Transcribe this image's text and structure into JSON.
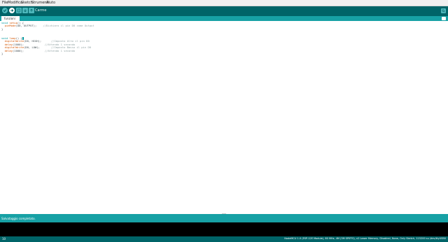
{
  "menubar": {
    "items": [
      "File",
      "Modifica",
      "Sketch",
      "Strumenti",
      "Aiuto"
    ]
  },
  "toolbar": {
    "buttons": [
      "verify-icon",
      "upload-icon",
      "new-icon",
      "open-icon",
      "save-icon"
    ],
    "sketch_name": "Carme"
  },
  "tabs": {
    "active": "funzioni"
  },
  "editor": {
    "lines": [
      {
        "kw": "void",
        "fn": "setup",
        "rest": "() {",
        "cm": ""
      },
      {
        "kw": "",
        "fn": "  pinMode",
        "rest": "(D0, OUTPUT);",
        "cm": "    //Dichiaro il pin D0 come Output"
      },
      {
        "kw": "",
        "fn": "",
        "rest": "}",
        "cm": ""
      },
      {
        "kw": "",
        "fn": "",
        "rest": "",
        "cm": ""
      },
      {
        "kw": "",
        "fn": "",
        "rest": "",
        "cm": ""
      },
      {
        "kw": "void",
        "fn": "loop",
        "rest": "() {",
        "cm": ""
      },
      {
        "kw": "",
        "fn": "  digitalWrite",
        "rest": "(D0, HIGH);",
        "cm": "      //Imposto Alto il pin D0"
      },
      {
        "kw": "",
        "fn": "  delay",
        "rest": "(1000);",
        "cm": "             //Attendo 1 secondo"
      },
      {
        "kw": "",
        "fn": "  digitalWrite",
        "rest": "(D0, LOW);",
        "cm": "       //Imposto Basso il pin D0"
      },
      {
        "kw": "",
        "fn": "  delay",
        "rest": "(1000);",
        "cm": "             //Attendo 1 secondo"
      },
      {
        "kw": "",
        "fn": "",
        "rest": "}",
        "cm": ""
      }
    ]
  },
  "status": {
    "text": "Salvataggio completato."
  },
  "footer": {
    "line_number": "10",
    "board": "NodeMCU 1.0 (ESP-12E Module), 80 MHz, 4M (3M SPIFFS), v2 Lower Memory, Disabled, None, Only Sketch, 115200 su /dev/ttyUSB0"
  },
  "colors": {
    "toolbar": "#006468",
    "tabbar": "#17a1a5",
    "keyword": "#00979d",
    "function": "#d35400",
    "comment": "#95a5a6"
  }
}
